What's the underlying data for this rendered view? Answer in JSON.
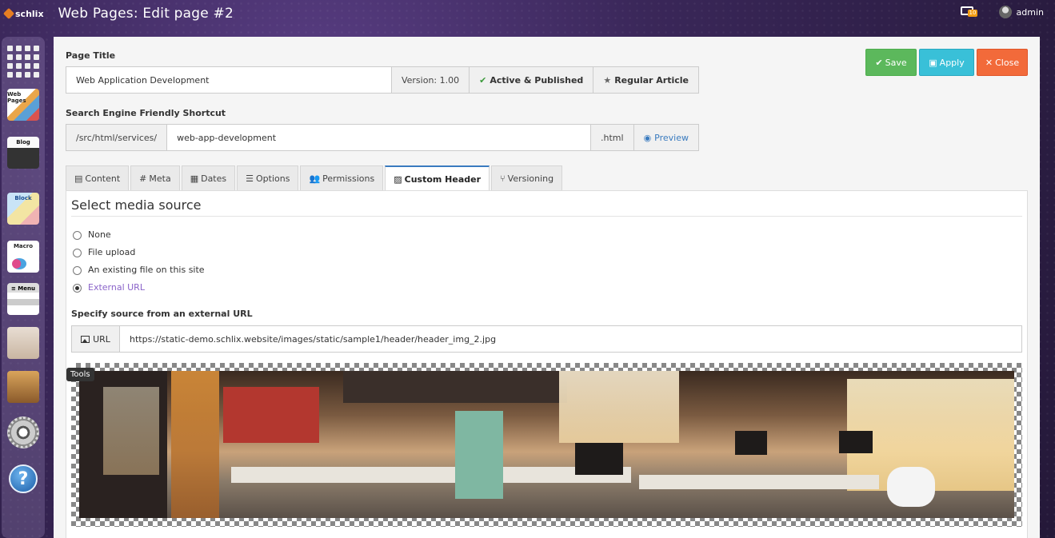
{
  "app": {
    "brand": "schlix",
    "page_heading": "Web Pages: Edit page #2"
  },
  "topbar": {
    "notification_count": "10",
    "user_name": "admin"
  },
  "dock": {
    "items": [
      {
        "name": "apps",
        "label": ""
      },
      {
        "name": "web-pages",
        "label": "Web Pages"
      },
      {
        "name": "blog",
        "label": "Blog"
      },
      {
        "name": "block",
        "label": "Block"
      },
      {
        "name": "macro",
        "label": "Macro"
      },
      {
        "name": "menu",
        "label": "≡ Menu"
      },
      {
        "name": "users",
        "label": ""
      },
      {
        "name": "tools",
        "label": ""
      },
      {
        "name": "settings",
        "label": ""
      },
      {
        "name": "help",
        "label": "?"
      }
    ]
  },
  "form": {
    "page_title_label": "Page Title",
    "page_title_value": "Web Application Development",
    "version": "Version: 1.00",
    "status": "Active & Published",
    "article_type": "Regular Article",
    "sef_label": "Search Engine Friendly Shortcut",
    "sef_prefix": "/src/html/services/",
    "sef_value": "web-app-development",
    "sef_suffix": ".html",
    "preview": "Preview"
  },
  "actions": {
    "save": "Save",
    "apply": "Apply",
    "close": "Close"
  },
  "tabs": [
    {
      "label": "Content",
      "icon": "file-icon",
      "active": false
    },
    {
      "label": "Meta",
      "icon": "hash-icon",
      "active": false
    },
    {
      "label": "Dates",
      "icon": "calendar-icon",
      "active": false
    },
    {
      "label": "Options",
      "icon": "options-icon",
      "active": false
    },
    {
      "label": "Permissions",
      "icon": "users-icon",
      "active": false
    },
    {
      "label": "Custom Header",
      "icon": "image-icon",
      "active": true
    },
    {
      "label": "Versioning",
      "icon": "branch-icon",
      "active": false
    }
  ],
  "custom_header": {
    "section_title": "Select media source",
    "options": [
      {
        "label": "None",
        "checked": false
      },
      {
        "label": "File upload",
        "checked": false
      },
      {
        "label": "An existing file on this site",
        "checked": false
      },
      {
        "label": "External URL",
        "checked": true
      }
    ],
    "url_label": "Specify source from an external URL",
    "url_addon": "URL",
    "url_value": "https://static-demo.schlix.website/images/static/sample1/header/header_img_2.jpg",
    "tools_label": "Tools"
  },
  "colors": {
    "save": "#5cb85c",
    "apply": "#39c0d8",
    "close": "#f26a3a",
    "accent": "#3a7bbf",
    "selected_option": "#8a63c9"
  }
}
